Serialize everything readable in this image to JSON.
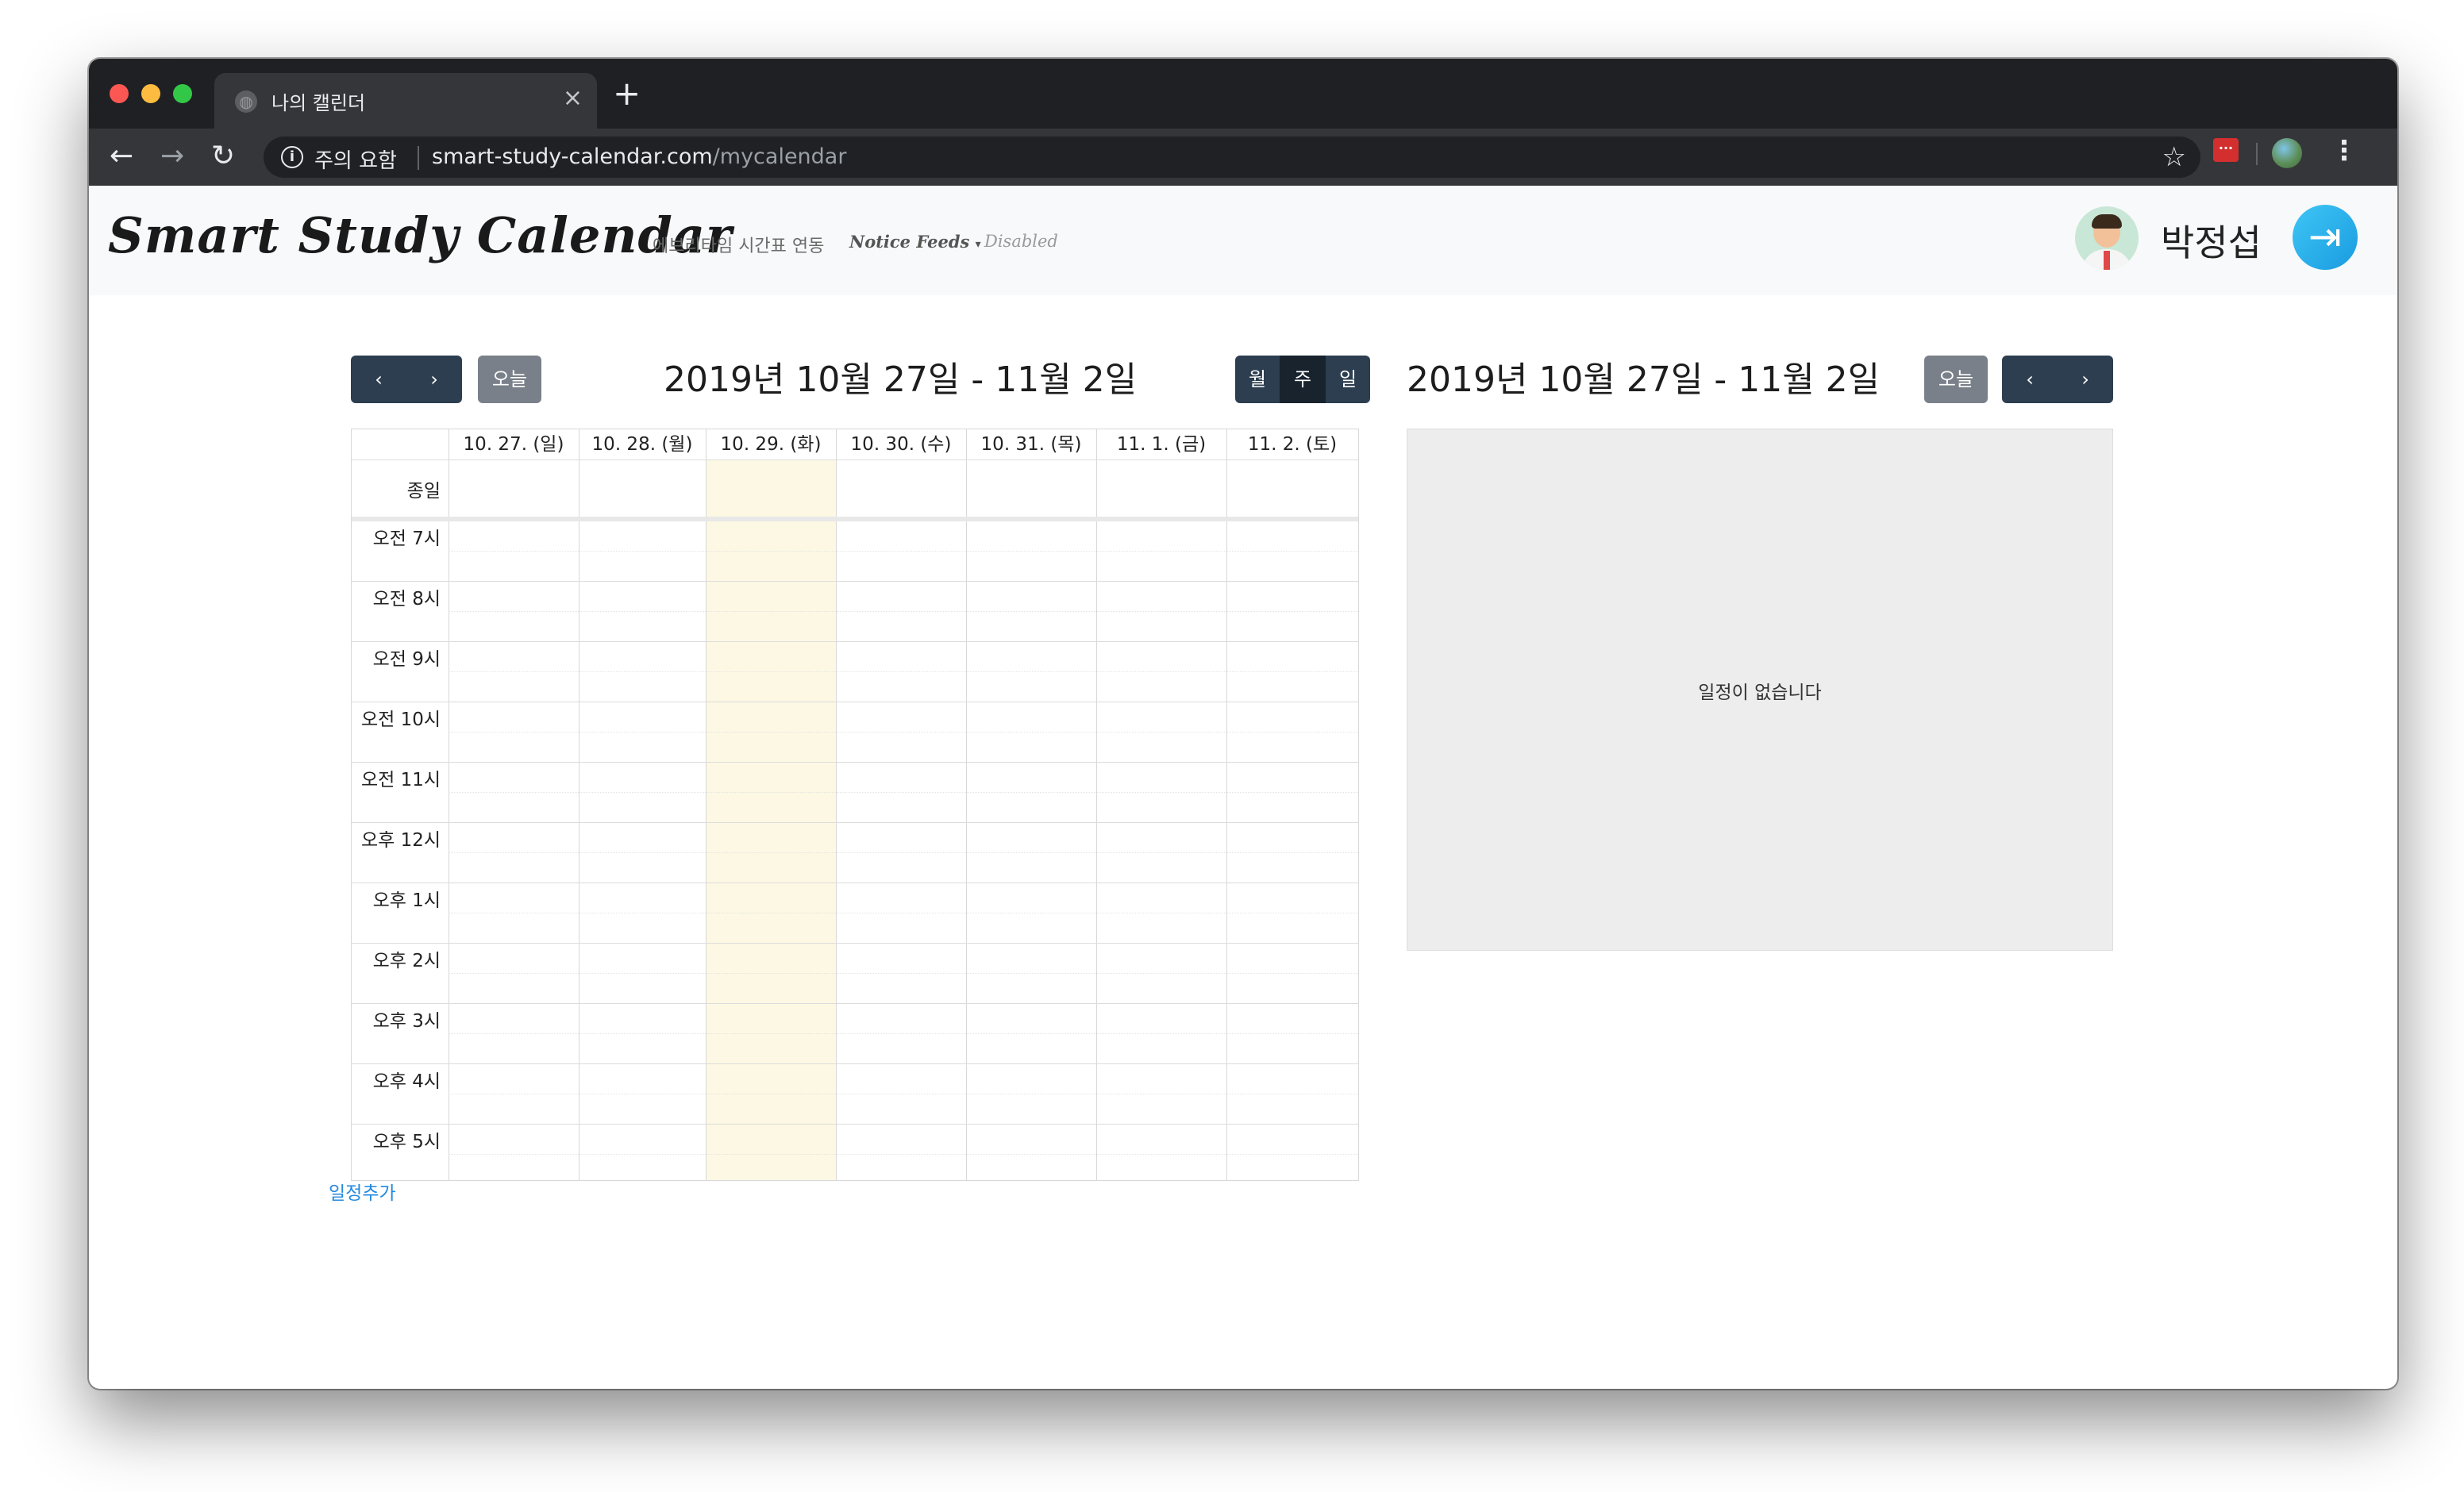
{
  "browser": {
    "tab_title": "나의 캘린더",
    "tab_close": "×",
    "new_tab": "+",
    "security_label": "주의 요함",
    "url_host": "smart-study-calendar.com",
    "url_path": "/mycalendar",
    "icons": {
      "back": "arrow-left-icon",
      "forward": "arrow-right-icon",
      "reload": "reload-icon",
      "info": "info-icon",
      "star": "star-icon",
      "extension": "extension-icon",
      "menu": "menu-icon"
    }
  },
  "navbar": {
    "brand": "Smart Study Calendar",
    "links": [
      "에브리타임 시간표 연동",
      "Notice Feeds",
      "Disabled"
    ],
    "user_name": "박정섭",
    "logout_icon": "logout-icon"
  },
  "calendar": {
    "prev": "‹",
    "next": "›",
    "today_button": "오늘",
    "title": "2019년 10월 27일 - 11월 2일",
    "views": [
      "월",
      "주",
      "일"
    ],
    "active_view": "주",
    "days": [
      "10. 27. (일)",
      "10. 28. (월)",
      "10. 29. (화)",
      "10. 30. (수)",
      "10. 31. (목)",
      "11. 1. (금)",
      "11. 2. (토)"
    ],
    "today_index": 2,
    "all_day_label": "종일",
    "time_slots": [
      "오전 7시",
      "오전 8시",
      "오전 9시",
      "오전 10시",
      "오전 11시",
      "오후 12시",
      "오후 1시",
      "오후 2시",
      "오후 3시",
      "오후 4시",
      "오후 5시"
    ],
    "add_event": "일정추가",
    "today_highlight_color": "#fcf8e3"
  },
  "list_view": {
    "today_button": "오늘",
    "title": "2019년 10월 27일 - 11월 2일",
    "prev": "‹",
    "next": "›",
    "empty_message": "일정이 없습니다"
  },
  "colors": {
    "button_dark": "#2c3e50",
    "button_grey": "#7a8089",
    "link": "#2389e0"
  }
}
